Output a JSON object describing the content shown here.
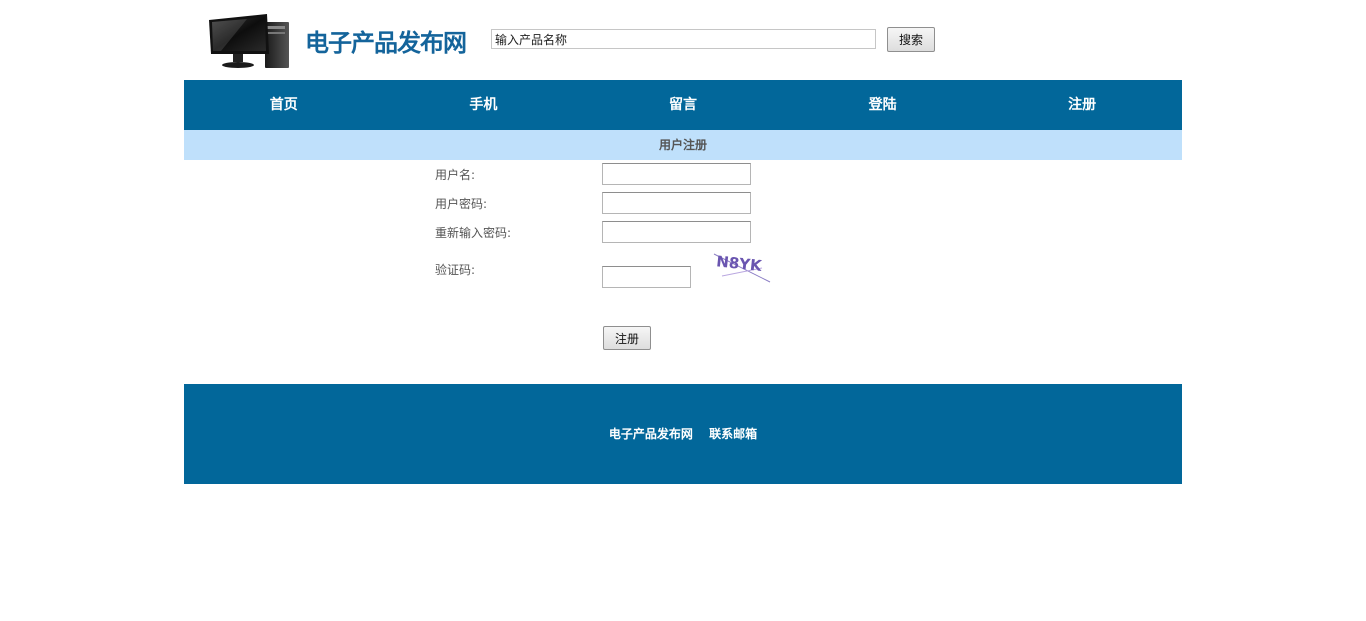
{
  "header": {
    "logo_text": "电子产品发布网",
    "search_value": "输入产品名称",
    "search_button": "搜索"
  },
  "nav": {
    "items": [
      {
        "label": "首页"
      },
      {
        "label": "手机"
      },
      {
        "label": "留言"
      },
      {
        "label": "登陆"
      },
      {
        "label": "注册"
      }
    ]
  },
  "form": {
    "title": "用户注册",
    "username_label": "用户名:",
    "password_label": "用户密码:",
    "confirm_password_label": "重新输入密码:",
    "captcha_label": "验证码:",
    "captcha_text": "N8YK",
    "submit_label": "注册"
  },
  "footer": {
    "site_name": "电子产品发布网",
    "contact": "联系邮箱"
  },
  "colors": {
    "brand_blue": "#02679a",
    "section_bar": "#bfe0fb",
    "logo_text": "#14649b"
  }
}
